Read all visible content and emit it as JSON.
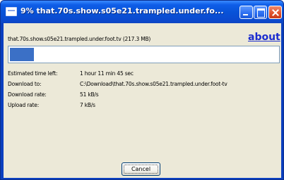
{
  "window": {
    "title": "9% that.70s.show.s05e21.trampled.under.fo...",
    "buttons": {
      "minimize": "minimize",
      "maximize": "maximize",
      "close": "close"
    }
  },
  "header": {
    "file_label": "that.70s.show.s05e21.trampled.under.foot.tv (217.3 MB)",
    "about_link": "about"
  },
  "progress": {
    "fraction": 0.09,
    "color": "#3b70c6"
  },
  "info": [
    {
      "label": "Estimated time left:",
      "value": "1 hour 11 min 45 sec"
    },
    {
      "label": "Download to:",
      "value": "C:\\Download\\that.70s.show.s05e21.trampled.under.foot-tv"
    },
    {
      "label": "Download rate:",
      "value": "51 kB/s"
    },
    {
      "label": "Upload rate:",
      "value": "7 kB/s"
    }
  ],
  "footer": {
    "cancel_label": "Cancel"
  },
  "colors": {
    "title_bar": "#0853d8",
    "client_bg": "#ece9d8",
    "link": "#1b2ccf"
  }
}
